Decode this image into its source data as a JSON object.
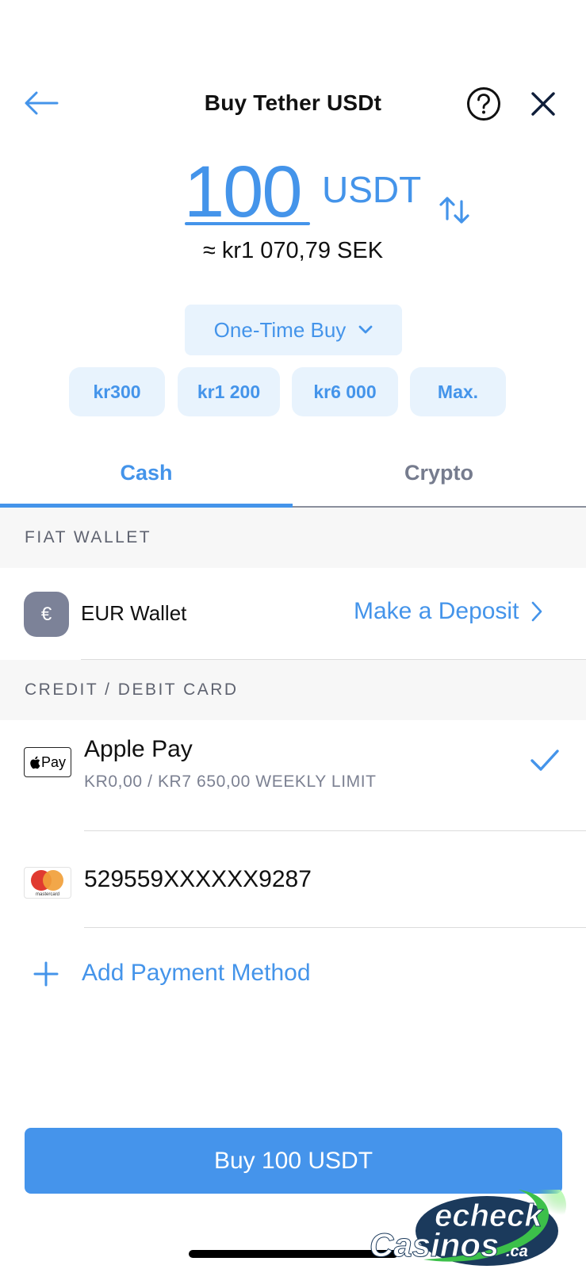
{
  "header": {
    "title": "Buy Tether USDt",
    "back_icon": "arrow-left-icon",
    "help_icon": "question-circle-icon",
    "close_icon": "close-icon"
  },
  "amount": {
    "value": "100",
    "currency": "USDT",
    "converted": "≈ kr1 070,79 SEK",
    "swap_icon": "swap-arrows-icon"
  },
  "purchase_type": {
    "selected": "One-Time Buy",
    "icon": "chevron-down-icon"
  },
  "presets": [
    "kr300",
    "kr1 200",
    "kr6 000",
    "Max."
  ],
  "tabs": [
    {
      "label": "Cash",
      "active": true
    },
    {
      "label": "Crypto",
      "active": false
    }
  ],
  "fiat_wallet": {
    "section_title": "FIAT WALLET",
    "wallet_symbol": "€",
    "wallet_name": "EUR Wallet",
    "action_label": "Make a Deposit"
  },
  "cards": {
    "section_title": "CREDIT / DEBIT CARD",
    "methods": [
      {
        "name": "Apple Pay",
        "logo_text": "Pay",
        "subtitle": "KR0,00 / KR7 650,00 WEEKLY LIMIT",
        "selected": true
      },
      {
        "name": "529559XXXXXX9287",
        "logo_text": "mastercard",
        "selected": false
      }
    ],
    "add_label": "Add Payment Method"
  },
  "buy_button": {
    "label": "Buy 100 USDT"
  },
  "watermark": {
    "line1": "echeck",
    "line2": "Casinos",
    "suffix": ".ca"
  },
  "colors": {
    "accent": "#4494ea",
    "accent_bg": "#e8f3fd",
    "section_bg": "#f7f7f7",
    "muted_text": "#7c8192",
    "wallet_icon_bg": "#7c8298"
  }
}
